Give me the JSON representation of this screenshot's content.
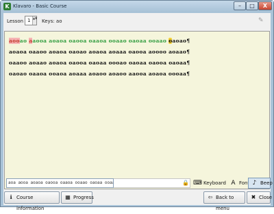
{
  "window": {
    "title": "Klavaro - Basic Course",
    "app_icon": "K",
    "minimize": "–",
    "maximize": "□",
    "close": "X"
  },
  "lesson": {
    "label": "Lesson",
    "value": "1",
    "keys_text": "Keys: ao"
  },
  "icons": {
    "edit": "✎",
    "spinner": "▲▼",
    "lock": "🔒",
    "keyboard": "⌨",
    "font": "A",
    "beep": "♪",
    "info": "ℹ",
    "progress": "▦",
    "back": "⇦",
    "close": "✖"
  },
  "text": {
    "lines": [
      "aooao aaooa aoaoa oaooa oaaoa ooaao oaoaa ooaao oaoao¶",
      "aoaoa oaaoo aoaoa oaoao aoaoa aoaaa oaooa aoooo aoaao¶",
      "oaaoo aoaao aoaoa oaooa oaoaa oooao oaoaa oaooa oaoaa¶",
      "oaoao oaaoa ooaoa aoaaa aoaoo aoaoo aaooa aoaoa oooaa¶"
    ],
    "typed_count": 48,
    "error_positions": [
      0,
      1,
      2,
      6
    ],
    "colors": {
      "done": "#2e9b3d",
      "error": "#c0392b",
      "error_bg": "#f6b3b3",
      "cursor_bg": "#f3d036",
      "panel_bg": "#f5f5dc"
    }
  },
  "input": {
    "value": "aoa aooa aoaoa oaooa oaaoa ooaao oaoaa ooaao"
  },
  "tools": {
    "keyboard_label": "Keyboard",
    "font_label": "Font",
    "beep_label": "Beep"
  },
  "footer": {
    "course_info_label": "Course information",
    "progress_label": "Progress",
    "back_menu_label": "Back to menu",
    "close_label": "Close"
  }
}
